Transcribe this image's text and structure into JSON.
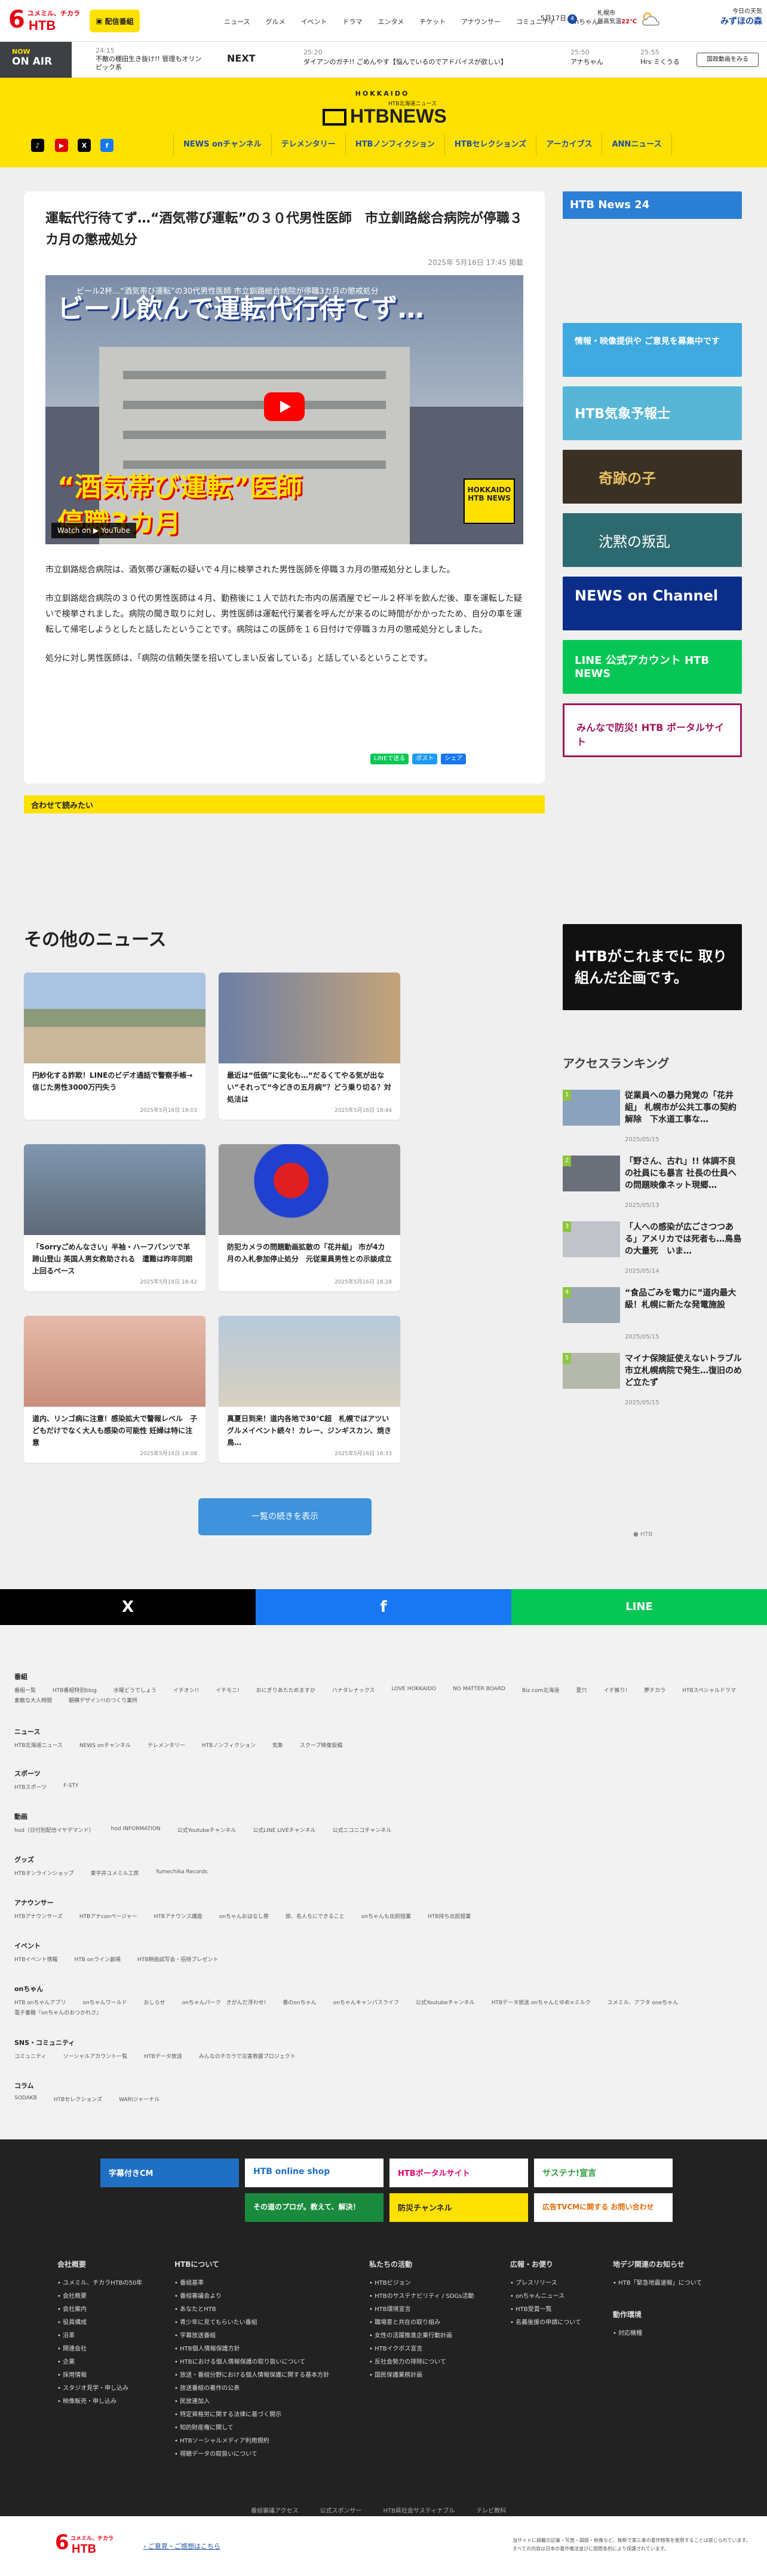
{
  "header": {
    "logo_tagline": "ユメミル、チカラ",
    "logo_text": "HTB",
    "live_label": "配信番組",
    "nav": [
      "ニュース",
      "グルメ",
      "イベント",
      "ドラマ",
      "エンタメ",
      "チケット",
      "アナウンサー",
      "コミュニティ",
      "onちゃん"
    ],
    "date": "5月17日",
    "count": "4",
    "weather_place": "札幌市",
    "weather_label": "最高気温",
    "weather_temp": "22℃",
    "sponsor_line1": "今日の天気",
    "sponsor_brand": "みずほの森"
  },
  "onair": {
    "now": "NOW",
    "on_air": "ON AIR",
    "now_time": "24:15",
    "now_title": "不敵の棚田生き抜け!! 管理もオリンピック系",
    "next_label": "NEXT",
    "next": [
      {
        "time": "25:20",
        "title": "ダイアンのガチ!! ごめんやす【悩んでいるのでアドバイスが欲しい】"
      },
      {
        "time": "25:50",
        "title": "アナちゃん"
      },
      {
        "time": "25:55",
        "title": "Hrs ミくうる"
      }
    ],
    "gov_button": "国政動画をみる"
  },
  "brand": {
    "hokkaido": "HOKKAIDO",
    "sub": "HTB北海道ニュース",
    "name": "HTBNEWS"
  },
  "social": [
    {
      "name": "tiktok-icon",
      "glyph": "♪",
      "color": "#000000"
    },
    {
      "name": "youtube-icon",
      "glyph": "▶",
      "color": "#e00000"
    },
    {
      "name": "x-icon",
      "glyph": "X",
      "color": "#000000"
    },
    {
      "name": "facebook-icon",
      "glyph": "f",
      "color": "#1877f2"
    }
  ],
  "main_nav": [
    "NEWS onチャンネル",
    "テレメンタリー",
    "HTBノンフィクション",
    "HTBセレクションズ",
    "アーカイブス",
    "ANNニュース"
  ],
  "article": {
    "title": "運転代行待てず…“酒気帯び運転”の３０代男性医師　市立釧路総合病院が停職３カ月の懲戒処分",
    "date": "2025年 5月16日 17:45 掲載",
    "video_title": "ビール2杯…“酒気帯び運転”の30代男性医師 市立釧路総合病院が停職3カ月の懲戒処分",
    "video_caption_top": "ビール飲んで運転代行待てず…",
    "video_caption_mid": "“酒気帯び運転”医師",
    "video_caption_bot": "停職3カ月",
    "watch_on": "Watch on ▶ YouTube",
    "badge": "HOKKAIDO HTB NEWS",
    "paragraphs": [
      "市立釧路総合病院は、酒気帯び運転の疑いで４月に検挙された男性医師を停職３カ月の懲戒処分としました。",
      "市立釧路総合病院の３０代の男性医師は４月、勤務後に１人で訪れた市内の居酒屋でビール２杯半を飲んだ後、車を運転した疑いで検挙されました。病院の聞き取りに対し、男性医師は運転代行業者を呼んだが来るのに時間がかかったため、自分の車を運転して帰宅しようとしたと話したということです。病院はこの医師を１６日付けで停職３カ月の懲戒処分としました。",
      "処分に対し男性医師は、「病院の信頼失墜を招いてしまい反省している」と話しているということです。"
    ],
    "share": [
      "LINEで送る",
      "ポスト",
      "シェア"
    ],
    "read_also": "合わせて読みたい"
  },
  "banners": [
    {
      "name": "news24-banner",
      "text": "HTB News 24"
    },
    {
      "name": "info-banner",
      "text": "情報・映像提供や ご意見を募集中です"
    },
    {
      "name": "weather-banner",
      "text": "HTB気象予報士"
    },
    {
      "name": "kiseki-banner",
      "text": "奇跡の子"
    },
    {
      "name": "chinmoku-banner",
      "text": "沈黙の叛乱"
    },
    {
      "name": "newsonchannel-banner",
      "text": "NEWS on Channel"
    },
    {
      "name": "line-banner",
      "text": "LINE 公式アカウント HTB NEWS"
    },
    {
      "name": "bousai-banner",
      "text": "みんなで防災! HTB ポータルサイト"
    }
  ],
  "other_news": {
    "title": "その他のニュース",
    "items": [
      {
        "text": "円紗化する詐欺！LINEのビデオ通話で警察手帳→信じた男性3000万円失う",
        "date": "2025年5月16日 19:03"
      },
      {
        "text": "最近は“低価”に変化も…“だるくてやる気が出ない”それって“今どきの五月病”？どう乗り切る？対処法は",
        "date": "2025年5月16日 18:44"
      },
      {
        "text": "「Sorryごめんなさい」半袖・ハーフパンツで羊蹄山登山 英国人男女救助される　遭難は昨年同期上回るペース",
        "date": "2025年5月16日 18:42"
      },
      {
        "text": "防犯カメラの問題動画拡散の「花井組」 市が4カ月の入札参加停止処分　元従業員男性との示談成立",
        "date": "2025年5月16日 18:28"
      },
      {
        "text": "道内、リンゴ病に注意！感染拡大で警報レベル　子どもだけでなく大人も感染の可能性 妊婦は特に注意",
        "date": "2025年5月16日 18:08"
      },
      {
        "text": "真夏日到来！道内各地で30℃超　札幌ではアツいグルメイベント続々！カレー、ジンギスカン、焼き鳥…",
        "date": "2025年5月16日 16:33"
      }
    ],
    "more": "一覧の続きを表示"
  },
  "promo": {
    "text": "HTBがこれまでに 取り組んだ企画です。"
  },
  "ranking": {
    "title": "アクセスランキング",
    "items": [
      {
        "num": "1",
        "text": "従業員への暴力発覚の「花井組」 札幌市が公共工事の契約解除　下水道工事な…",
        "date": "2025/05/15"
      },
      {
        "num": "2",
        "text": "「野さん、古れ」!! 体調不良の社員にも暴言 社長の仕員への問題映像ネット現郷…",
        "date": "2025/05/13"
      },
      {
        "num": "3",
        "text": "「人への感染が広ごさつつある」アメリカでは死者も…鳥島の大量死　いま…",
        "date": "2025/05/14"
      },
      {
        "num": "4",
        "text": "“食品ごみを電力に”道内最大級！札幌に新たな発電施設",
        "date": "2025/05/15"
      },
      {
        "num": "5",
        "text": "マイナ保険証使えないトラブル　市立札幌病院で発生…復旧のめど立たず",
        "date": "2025/05/15"
      }
    ],
    "footer": "HTB"
  },
  "sharebar": [
    "X",
    "f",
    "LINE"
  ],
  "footer_sections": [
    {
      "title": "番組",
      "links": [
        "番組一覧",
        "HTB番組特別blog",
        "水曜どうでしょう",
        "イチオシ!!",
        "イチモニ!",
        "おにぎりあたためますか",
        "ハナタレナックス",
        "LOVE HOKKAIDO",
        "NO MATTER BOARD",
        "Biz.com北海道",
        "夏穴",
        "イチ推り!",
        "夢チカラ",
        "HTBスペシャルドラマ",
        "素敵な大人時間",
        "朝横デザイン!!のつくり案所"
      ]
    },
    {
      "title": "ニュース",
      "links": [
        "HTB北海道ニュース",
        "NEWS onチャンネル",
        "テレメンタリー",
        "HTBノンフィクション",
        "気象",
        "スクープ映像投稿"
      ]
    },
    {
      "title": "スポーツ",
      "links": [
        "HTBスポーツ",
        "F-STY"
      ]
    },
    {
      "title": "動画",
      "links": [
        "hod（日付別配信イヤデマンド）",
        "hod INFORMATION",
        "公式Youtubeチャンネル",
        "公式LINE LIVEチャンネル",
        "公式ニコニコチャンネル"
      ]
    },
    {
      "title": "グッズ",
      "links": [
        "HTBオンラインショップ",
        "東平井ユメミル工房",
        "Yumechika Records"
      ]
    },
    {
      "title": "アナウンサー",
      "links": [
        "HTBアナウンサーズ",
        "HTBアナconページャー",
        "HTBアナウンス講座",
        "onちゃんおはなし祭",
        "旅、名人ちにできること",
        "onちゃんも出前授業",
        "HTB持ち出前授業"
      ]
    },
    {
      "title": "イベント",
      "links": [
        "HTBイベント情報",
        "HTB onライン劇場",
        "HTB映画試写会・招待プレゼント"
      ]
    },
    {
      "title": "onちゃん",
      "links": [
        "HTB onちゃんアプリ",
        "onちゃんワールド",
        "おしらせ",
        "onちゃんパーク　きがんだ浮わせ!",
        "春のonちゃん",
        "onちゃんキャンパスライフ",
        "公式Youtubeチャンネル",
        "HTBデータ放送 onちゃんとゆめ×ミルク",
        "ユメミル、アフタ oneちゃん",
        "電子書籍『onちゃんのおつかれさ』"
      ]
    },
    {
      "title": "SNS・コミュニティ",
      "links": [
        "コミュニティ",
        "ソーシャルアカウント一覧",
        "HTBデータ放送",
        "みんなのチカラで災害救援プロジェクト"
      ]
    },
    {
      "title": "コラム",
      "links": [
        "SODAKB",
        "HTBセレクションズ",
        "WARIジャーナル"
      ]
    }
  ],
  "footer_banners": [
    {
      "text": "字幕付きCM"
    },
    {
      "text": "HTB online shop"
    },
    {
      "text": "HTBポータルサイト"
    },
    {
      "text": "サステナ!宣言"
    },
    {
      "text": "その道のプロが。教えて、解決！"
    },
    {
      "text": "防災チャンネル"
    },
    {
      "text": "広告TVCMに関する お問い合わせ"
    }
  ],
  "footer_cols": [
    {
      "title": "会社概要",
      "links": [
        "ユメミル、チカラHTBの50年",
        "会社概要",
        "会社案内",
        "役員構成",
        "沿革",
        "関連会社",
        "企業",
        "採用情報",
        "スタジオ見学・申し込み",
        "映像販売・申し込み"
      ]
    },
    {
      "title": "HTBについて",
      "links": [
        "番組基準",
        "番組審議会より",
        "あなたとHTB",
        "青少年に見てもらいたい番組",
        "字幕放送番組",
        "HTB個人情報保護方針",
        "HTBにおける個人情報保護の取り扱いについて",
        "放送・番組分野における個人情報保護に関する基本方針",
        "放送番組の著作の公表",
        "民放連加入",
        "特定資格労に関する法律に基づく開示",
        "知的財産権に関して",
        "HTBソーシャルメディア利用規約",
        "視聴データの取扱いについて"
      ]
    },
    {
      "title": "私たちの活動",
      "links": [
        "HTBビジョン",
        "HTBのサステナビリティ / SDGs活動",
        "HTB環境宣言",
        "職場意と共在の取り組み",
        "女性の活躍推進企業行動計画",
        "HTBイクボス宣言",
        "反社会勢力の排除について",
        "国民保護業務計画"
      ]
    },
    {
      "title": "広報・お便り",
      "links": [
        "プレスリリース",
        "onちゃんニュース",
        "HTB受賞一覧",
        "名義後援の申請について"
      ]
    },
    {
      "title": "地デジ関連のお知らせ",
      "links": [
        "HTB「緊急地震速報」について"
      ]
    },
    {
      "title": "動作環境",
      "links": [
        "対応機種"
      ]
    }
  ],
  "footer_bottom_links": [
    "番組審議アクセス",
    "公式スポンサー",
    "HTB県社会サスティナブル",
    "テレビ教科"
  ],
  "bottom": {
    "contact": "ご意見・ご感想はこちら",
    "notice1": "当サイトに掲載の記事・写真・図版・映像など、無断で第三者の著作物等を使用することは禁じられています。",
    "notice2": "すべての内容は日本の著作権法並びに国際条約により保護されています。"
  }
}
